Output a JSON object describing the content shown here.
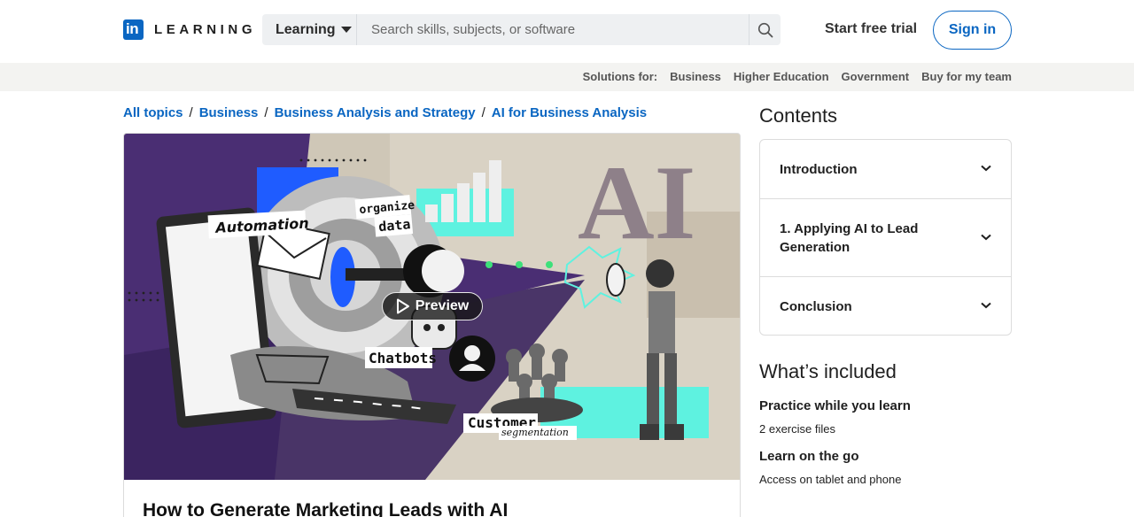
{
  "header": {
    "logo_letters": "in",
    "logo_text": "LEARNING",
    "search_category": "Learning",
    "search_placeholder": "Search skills, subjects, or software",
    "trial_label": "Start free trial",
    "signin_label": "Sign in"
  },
  "solutions": {
    "label": "Solutions for:",
    "items": [
      "Business",
      "Higher Education",
      "Government",
      "Buy for my team"
    ]
  },
  "breadcrumb": [
    "All topics",
    "Business",
    "Business Analysis and Strategy",
    "AI for Business Analysis"
  ],
  "course": {
    "preview_label": "Preview",
    "title": "How to Generate Marketing Leads with AI",
    "hero_words": {
      "automation": "Automation",
      "organize": "organize",
      "data": "data",
      "chatbots": "Chatbots",
      "customer": "Customer",
      "segmentation": "segmentation",
      "ai": "AI"
    }
  },
  "contents": {
    "heading": "Contents",
    "items": [
      "Introduction",
      "1. Applying AI to Lead Generation",
      "Conclusion"
    ]
  },
  "included": {
    "heading": "What’s included",
    "items": [
      {
        "title": "Practice while you learn",
        "detail": "2 exercise files"
      },
      {
        "title": "Learn on the go",
        "detail": "Access on tablet and phone"
      }
    ]
  },
  "colors": {
    "brand": "#0a66c2",
    "hero_purple": "#4a2e73",
    "hero_cyan": "#5ef2e0",
    "hero_blue": "#1f5cff"
  }
}
